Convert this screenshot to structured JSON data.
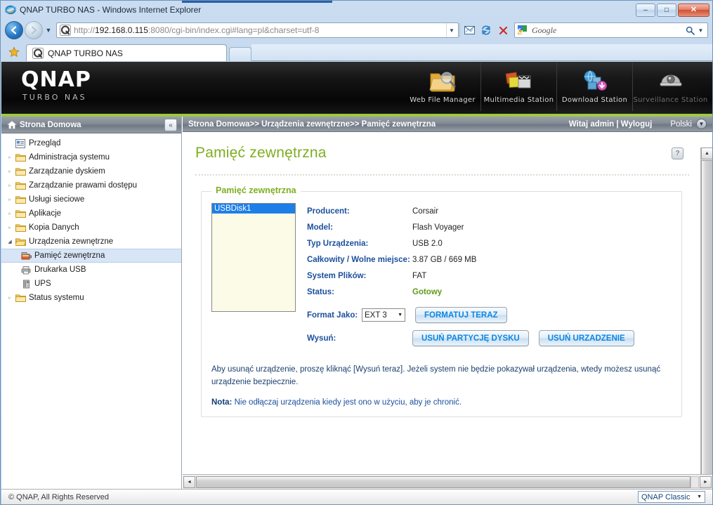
{
  "browser": {
    "window_title": "QNAP TURBO NAS - Windows Internet Explorer",
    "address_value": "http://192.168.0.115:8080/cgi-bin/index.cgi#lang=pl&charset=utf-8",
    "address_scheme": "http://",
    "address_host": "192.168.0.115",
    "address_rest": ":8080/cgi-bin/index.cgi#lang=pl&charset=utf-8",
    "search_placeholder": "Google",
    "tab_label": "QNAP TURBO NAS",
    "minimize_glyph": "–",
    "maximize_glyph": "□",
    "close_glyph": "✕",
    "back_glyph": "←",
    "forward_glyph": "→",
    "history_caret": "▼",
    "refresh_glyph": "↻",
    "stop_glyph": "✕",
    "compat_glyph": "▤",
    "search_mag": "⚲",
    "search_caret": "▼",
    "star_glyph": "★"
  },
  "banner": {
    "logo": "QNAP",
    "subtitle": "TURBO NAS",
    "apps": [
      {
        "label": "Web File Manager",
        "icon": "folder-search-icon",
        "dim": false
      },
      {
        "label": "Multimedia Station",
        "icon": "media-photos-icon",
        "dim": false
      },
      {
        "label": "Download Station",
        "icon": "download-globe-icon",
        "dim": false
      },
      {
        "label": "Surveillance Station",
        "icon": "security-camera-icon",
        "dim": true
      }
    ],
    "accent_color": "#9dc93f"
  },
  "sidebar": {
    "header": "Strona Domowa",
    "collapse_glyph": "«",
    "items": [
      {
        "label": "Przegląd",
        "type": "leaf",
        "icon": "overview-icon",
        "arrow": "",
        "selected": false
      },
      {
        "label": "Administracja systemu",
        "type": "folder",
        "icon": "folder-icon",
        "arrow": "▹",
        "selected": false
      },
      {
        "label": "Zarządzanie dyskiem",
        "type": "folder",
        "icon": "folder-icon",
        "arrow": "▹",
        "selected": false
      },
      {
        "label": "Zarządzanie prawami dostępu",
        "type": "folder",
        "icon": "folder-icon",
        "arrow": "▹",
        "selected": false
      },
      {
        "label": "Usługi sieciowe",
        "type": "folder",
        "icon": "folder-icon",
        "arrow": "▹",
        "selected": false
      },
      {
        "label": "Aplikacje",
        "type": "folder",
        "icon": "folder-icon",
        "arrow": "▹",
        "selected": false
      },
      {
        "label": "Kopia Danych",
        "type": "folder",
        "icon": "folder-icon",
        "arrow": "▹",
        "selected": false
      },
      {
        "label": "Urządzenia zewnętrzne",
        "type": "folder-open",
        "icon": "folder-open-icon",
        "arrow": "◢",
        "selected": false
      },
      {
        "label": "Pamięć zewnętrzna",
        "type": "child",
        "icon": "external-storage-icon",
        "arrow": "",
        "selected": true
      },
      {
        "label": "Drukarka USB",
        "type": "child",
        "icon": "printer-icon",
        "arrow": "",
        "selected": false
      },
      {
        "label": "UPS",
        "type": "child",
        "icon": "ups-icon",
        "arrow": "",
        "selected": false
      },
      {
        "label": "Status systemu",
        "type": "folder",
        "icon": "folder-icon",
        "arrow": "▹",
        "selected": false
      }
    ]
  },
  "topbar": {
    "breadcrumb": "Strona Domowa>> Urządzenia zewnętrzne>> Pamięć zewnętrzna",
    "welcome": "Witaj admin | Wyloguj",
    "language": "Polski",
    "language_caret": "▼"
  },
  "page": {
    "title": "Pamięć zewnętrzna",
    "help_glyph": "?",
    "panel_legend": "Pamięć zewnętrzna",
    "device_list": [
      "USBDisk1"
    ],
    "info_rows": [
      {
        "label": "Producent:",
        "value": "Corsair",
        "status": false
      },
      {
        "label": "Model:",
        "value": "Flash Voyager",
        "status": false
      },
      {
        "label": "Typ Urządzenia:",
        "value": "USB 2.0",
        "status": false
      },
      {
        "label": "Całkowity / Wolne miejsce:",
        "value": "3.87 GB / 669 MB",
        "status": false
      },
      {
        "label": "System Plików:",
        "value": "FAT",
        "status": false
      },
      {
        "label": "Status:",
        "value": "Gotowy",
        "status": true
      }
    ],
    "format_label": "Format Jako:",
    "format_value": "EXT 3",
    "format_caret": "▼",
    "format_button": "FORMATUJ TERAZ",
    "eject_label": "Wysuń:",
    "remove_partition_button": "USUŃ PARTYCJĘ DYSKU",
    "remove_device_button": "USUŃ URZADZENIE",
    "help_paragraph": "Aby usunąć urządzenie, proszę kliknąć [Wysuń teraz]. Jeżeli system nie będzie pokazywał urządzenia, wtedy możesz usunąć urządzenie bezpiecznie.",
    "note_prefix": "Nota:",
    "note_text": "Nie odłączaj urządzenia kiedy jest ono w użyciu, aby je chronić."
  },
  "footer": {
    "copyright": "© QNAP, All Rights Reserved",
    "theme_value": "QNAP Classic",
    "theme_caret": "▼"
  },
  "scroll": {
    "up_glyph": "▲",
    "down_glyph": "▼",
    "left_glyph": "◄",
    "right_glyph": "►"
  },
  "colors": {
    "brand_green": "#7fae21",
    "accent_bar": "#9dc93f",
    "label_blue": "#1b4f9c",
    "button_text": "#0d86e3",
    "select_blue": "#1e7ee8",
    "status_green": "#5f9b1c"
  }
}
